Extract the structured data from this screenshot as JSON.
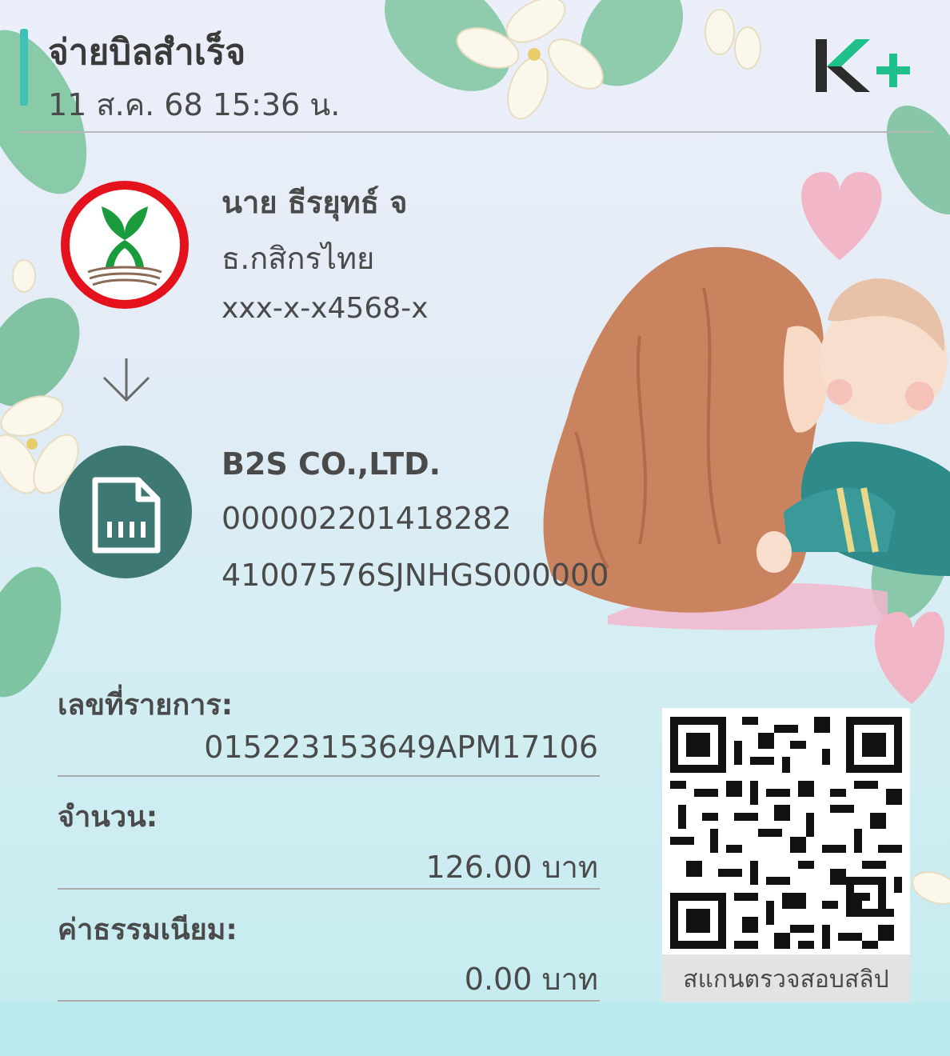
{
  "header": {
    "title": "จ่ายบิลสำเร็จ",
    "datetime": "11 ส.ค. 68  15:36 น.",
    "brand_logo": "K+"
  },
  "sender": {
    "name": "นาย ธีรยุทธ์ จ",
    "bank": "ธ.กสิกรไทย",
    "account": "xxx-x-x4568-x",
    "icon": "kbank-logo-icon"
  },
  "biller": {
    "name": "B2S CO.,LTD.",
    "ref1": "000002201418282",
    "ref2": "41007576SJNHGS000000",
    "icon": "bill-document-icon"
  },
  "details": {
    "transaction_label": "เลขที่รายการ:",
    "transaction_value": "015223153649APM17106",
    "amount_label": "จำนวน:",
    "amount_value": "126.00 บาท",
    "fee_label": "ค่าธรรมเนียม:",
    "fee_value": "0.00 บาท"
  },
  "qr": {
    "caption": "สแกนตรวจสอบสลิป"
  },
  "colors": {
    "accent": "#3fc2b5",
    "kbank_green": "#1a9b3c",
    "kbank_red": "#e3121c",
    "biller_icon_bg": "#3d7875"
  }
}
